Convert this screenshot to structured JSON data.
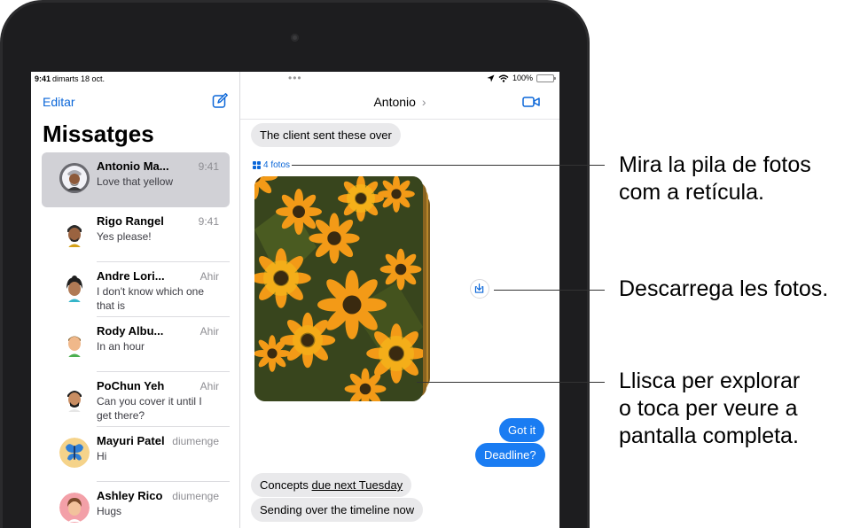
{
  "status_bar": {
    "time": "9:41",
    "date": "dimarts 18 oct.",
    "battery": "100%"
  },
  "sidebar": {
    "edit_label": "Editar",
    "title": "Missatges",
    "conversations": [
      {
        "name": "Antonio Ma...",
        "when": "9:41",
        "preview": "Love that yellow",
        "selected": true
      },
      {
        "name": "Rigo Rangel",
        "when": "9:41",
        "preview": "Yes please!"
      },
      {
        "name": "Andre Lori...",
        "when": "Ahir",
        "preview": "I don't know which one that is"
      },
      {
        "name": "Rody Albu...",
        "when": "Ahir",
        "preview": "In an hour"
      },
      {
        "name": "PoChun Yeh",
        "when": "Ahir",
        "preview": "Can you cover it until I get there?"
      },
      {
        "name": "Mayuri Patel",
        "when": "diumenge",
        "preview": "Hi"
      },
      {
        "name": "Ashley Rico",
        "when": "diumenge",
        "preview": "Hugs"
      }
    ]
  },
  "chat": {
    "contact": "Antonio",
    "contact_chevron": "›",
    "messages": {
      "incoming_1": "The client sent these over",
      "photos_label": "4 fotos",
      "outgoing_1": "Got it",
      "outgoing_2": "Deadline?",
      "incoming_2_prefix": "Concepts ",
      "incoming_2_link": "due next Tuesday",
      "incoming_3": "Sending over the timeline now"
    }
  },
  "callouts": {
    "grid": "Mira la pila de fotos com a retícula.",
    "grid_line1": "Mira la pila de fotos",
    "grid_line2": "com a retícula.",
    "download": "Descarrega les fotos.",
    "swipe_line1": "Llisca per explorar",
    "swipe_line2": "o toca per veure a",
    "swipe_line3": "pantalla completa."
  },
  "colors": {
    "accent": "#0a66d8",
    "outgoing_bubble": "#1a7cf2",
    "incoming_bubble": "#e9e9eb",
    "selected_row": "#d1d1d6"
  }
}
